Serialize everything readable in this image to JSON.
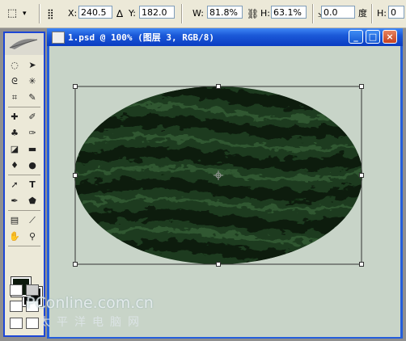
{
  "options_bar": {
    "x_label": "X:",
    "x_value": "240.5",
    "y_label": "Y:",
    "y_value": "182.0",
    "w_label": "W:",
    "w_value": "81.8%",
    "h_label": "H:",
    "h_value": "63.1%",
    "rotate_value": "0.0",
    "rotate_unit": "度",
    "skew_label": "H:",
    "skew_value": "0"
  },
  "document": {
    "title": "1.psd @ 100% (图层 3, RGB/8)",
    "minimize": "_",
    "maximize": "□",
    "close": "×"
  },
  "watermark": {
    "line1": "PConline.com.cn",
    "line2": "太平洋电脑网"
  },
  "colors": {
    "foreground": "#0d1a0d",
    "background": "#000000",
    "canvas": "#c8d4c8",
    "watermelon": "#1e3a1e"
  },
  "toolbox_icons": [
    "marquee-icon",
    "move-icon",
    "lasso-icon",
    "magic-wand-icon",
    "crop-icon",
    "slice-icon",
    "healing-icon",
    "brush-icon",
    "stamp-icon",
    "history-brush-icon",
    "eraser-icon",
    "gradient-icon",
    "blur-icon",
    "dodge-icon",
    "path-select-icon",
    "type-icon",
    "pen-icon",
    "shape-icon",
    "notes-icon",
    "eyedropper-icon",
    "hand-icon",
    "zoom-icon"
  ]
}
